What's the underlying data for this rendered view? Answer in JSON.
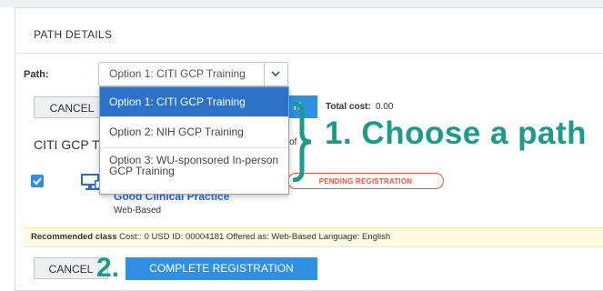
{
  "panel": {
    "title": "PATH DETAILS"
  },
  "path": {
    "label": "Path:",
    "selected": "Option 1: CITI GCP Training",
    "options": [
      "Option 1: CITI GCP Training",
      "Option 2: NIH GCP Training",
      "Option 3: WU-sponsored In-person GCP Training"
    ]
  },
  "actions_top": {
    "cancel_label": "CANCEL",
    "blue_label": "N"
  },
  "total_cost": {
    "label": "Total cost:",
    "value": "0.00"
  },
  "course": {
    "title_partial": "CITI GCP T",
    "of_text": "of",
    "name": "Good Clinical Practice",
    "format": "Web-Based",
    "status": "PENDING REGISTRATION"
  },
  "recommended": {
    "label": "Recommended class",
    "details": "Cost:: 0 USD  ID: 00004181  Offered as: Web-Based  Language: English"
  },
  "actions_bottom": {
    "cancel_label": "CANCEL",
    "complete_label": "COMPLETE REGISTRATION"
  },
  "annotations": {
    "step1": "1.  Choose a path",
    "step2": "2."
  },
  "colors": {
    "accent": "#2f8fe2",
    "annotation": "#1e9a8d",
    "pending": "#e8543f",
    "selected": "#2d72c9"
  },
  "icons": [
    "chevron-down-icon",
    "checkbox-checked-icon",
    "monitor-icon",
    "curly-brace"
  ]
}
